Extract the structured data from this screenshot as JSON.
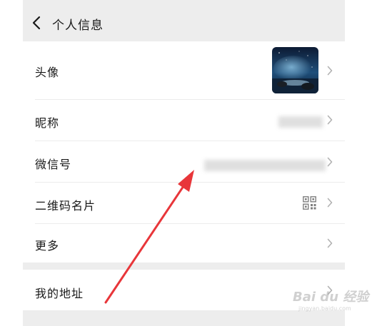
{
  "header": {
    "title": "个人信息"
  },
  "profile": {
    "rows": [
      {
        "label": "头像"
      },
      {
        "label": "昵称"
      },
      {
        "label": "微信号"
      },
      {
        "label": "二维码名片"
      },
      {
        "label": "更多"
      }
    ]
  },
  "address": {
    "label": "我的地址"
  },
  "watermark": {
    "text": "Bai du 经验",
    "sub": "jingyan.baidu.com"
  },
  "colors": {
    "background": "#ededed",
    "card": "#ffffff",
    "text": "#191919",
    "chevron": "#b2b2b2",
    "annotation_arrow": "#e8363a"
  },
  "icons": {
    "back": "chevron-left-icon",
    "chevron": "chevron-right-icon",
    "qr": "qr-code-icon"
  }
}
